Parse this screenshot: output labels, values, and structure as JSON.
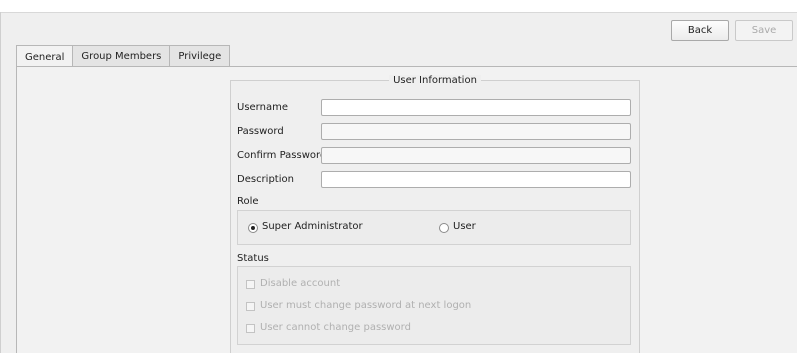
{
  "toolbar": {
    "back_label": "Back",
    "save_label": "Save"
  },
  "tabs": [
    {
      "label": "General",
      "active": true
    },
    {
      "label": "Group Members",
      "active": false
    },
    {
      "label": "Privilege",
      "active": false
    }
  ],
  "user_info": {
    "title": "User Information",
    "username_label": "Username",
    "username_value": "",
    "password_label": "Password",
    "password_value": "",
    "confirm_label": "Confirm Password",
    "confirm_value": "",
    "description_label": "Description",
    "description_value": ""
  },
  "role": {
    "label": "Role",
    "options": [
      {
        "label": "Super Administrator",
        "selected": true
      },
      {
        "label": "User",
        "selected": false
      }
    ]
  },
  "status": {
    "label": "Status",
    "options": [
      {
        "label": "Disable account",
        "checked": false,
        "enabled": false
      },
      {
        "label": "User must change password at next logon",
        "checked": false,
        "enabled": false
      },
      {
        "label": "User cannot change password",
        "checked": false,
        "enabled": false
      }
    ]
  }
}
